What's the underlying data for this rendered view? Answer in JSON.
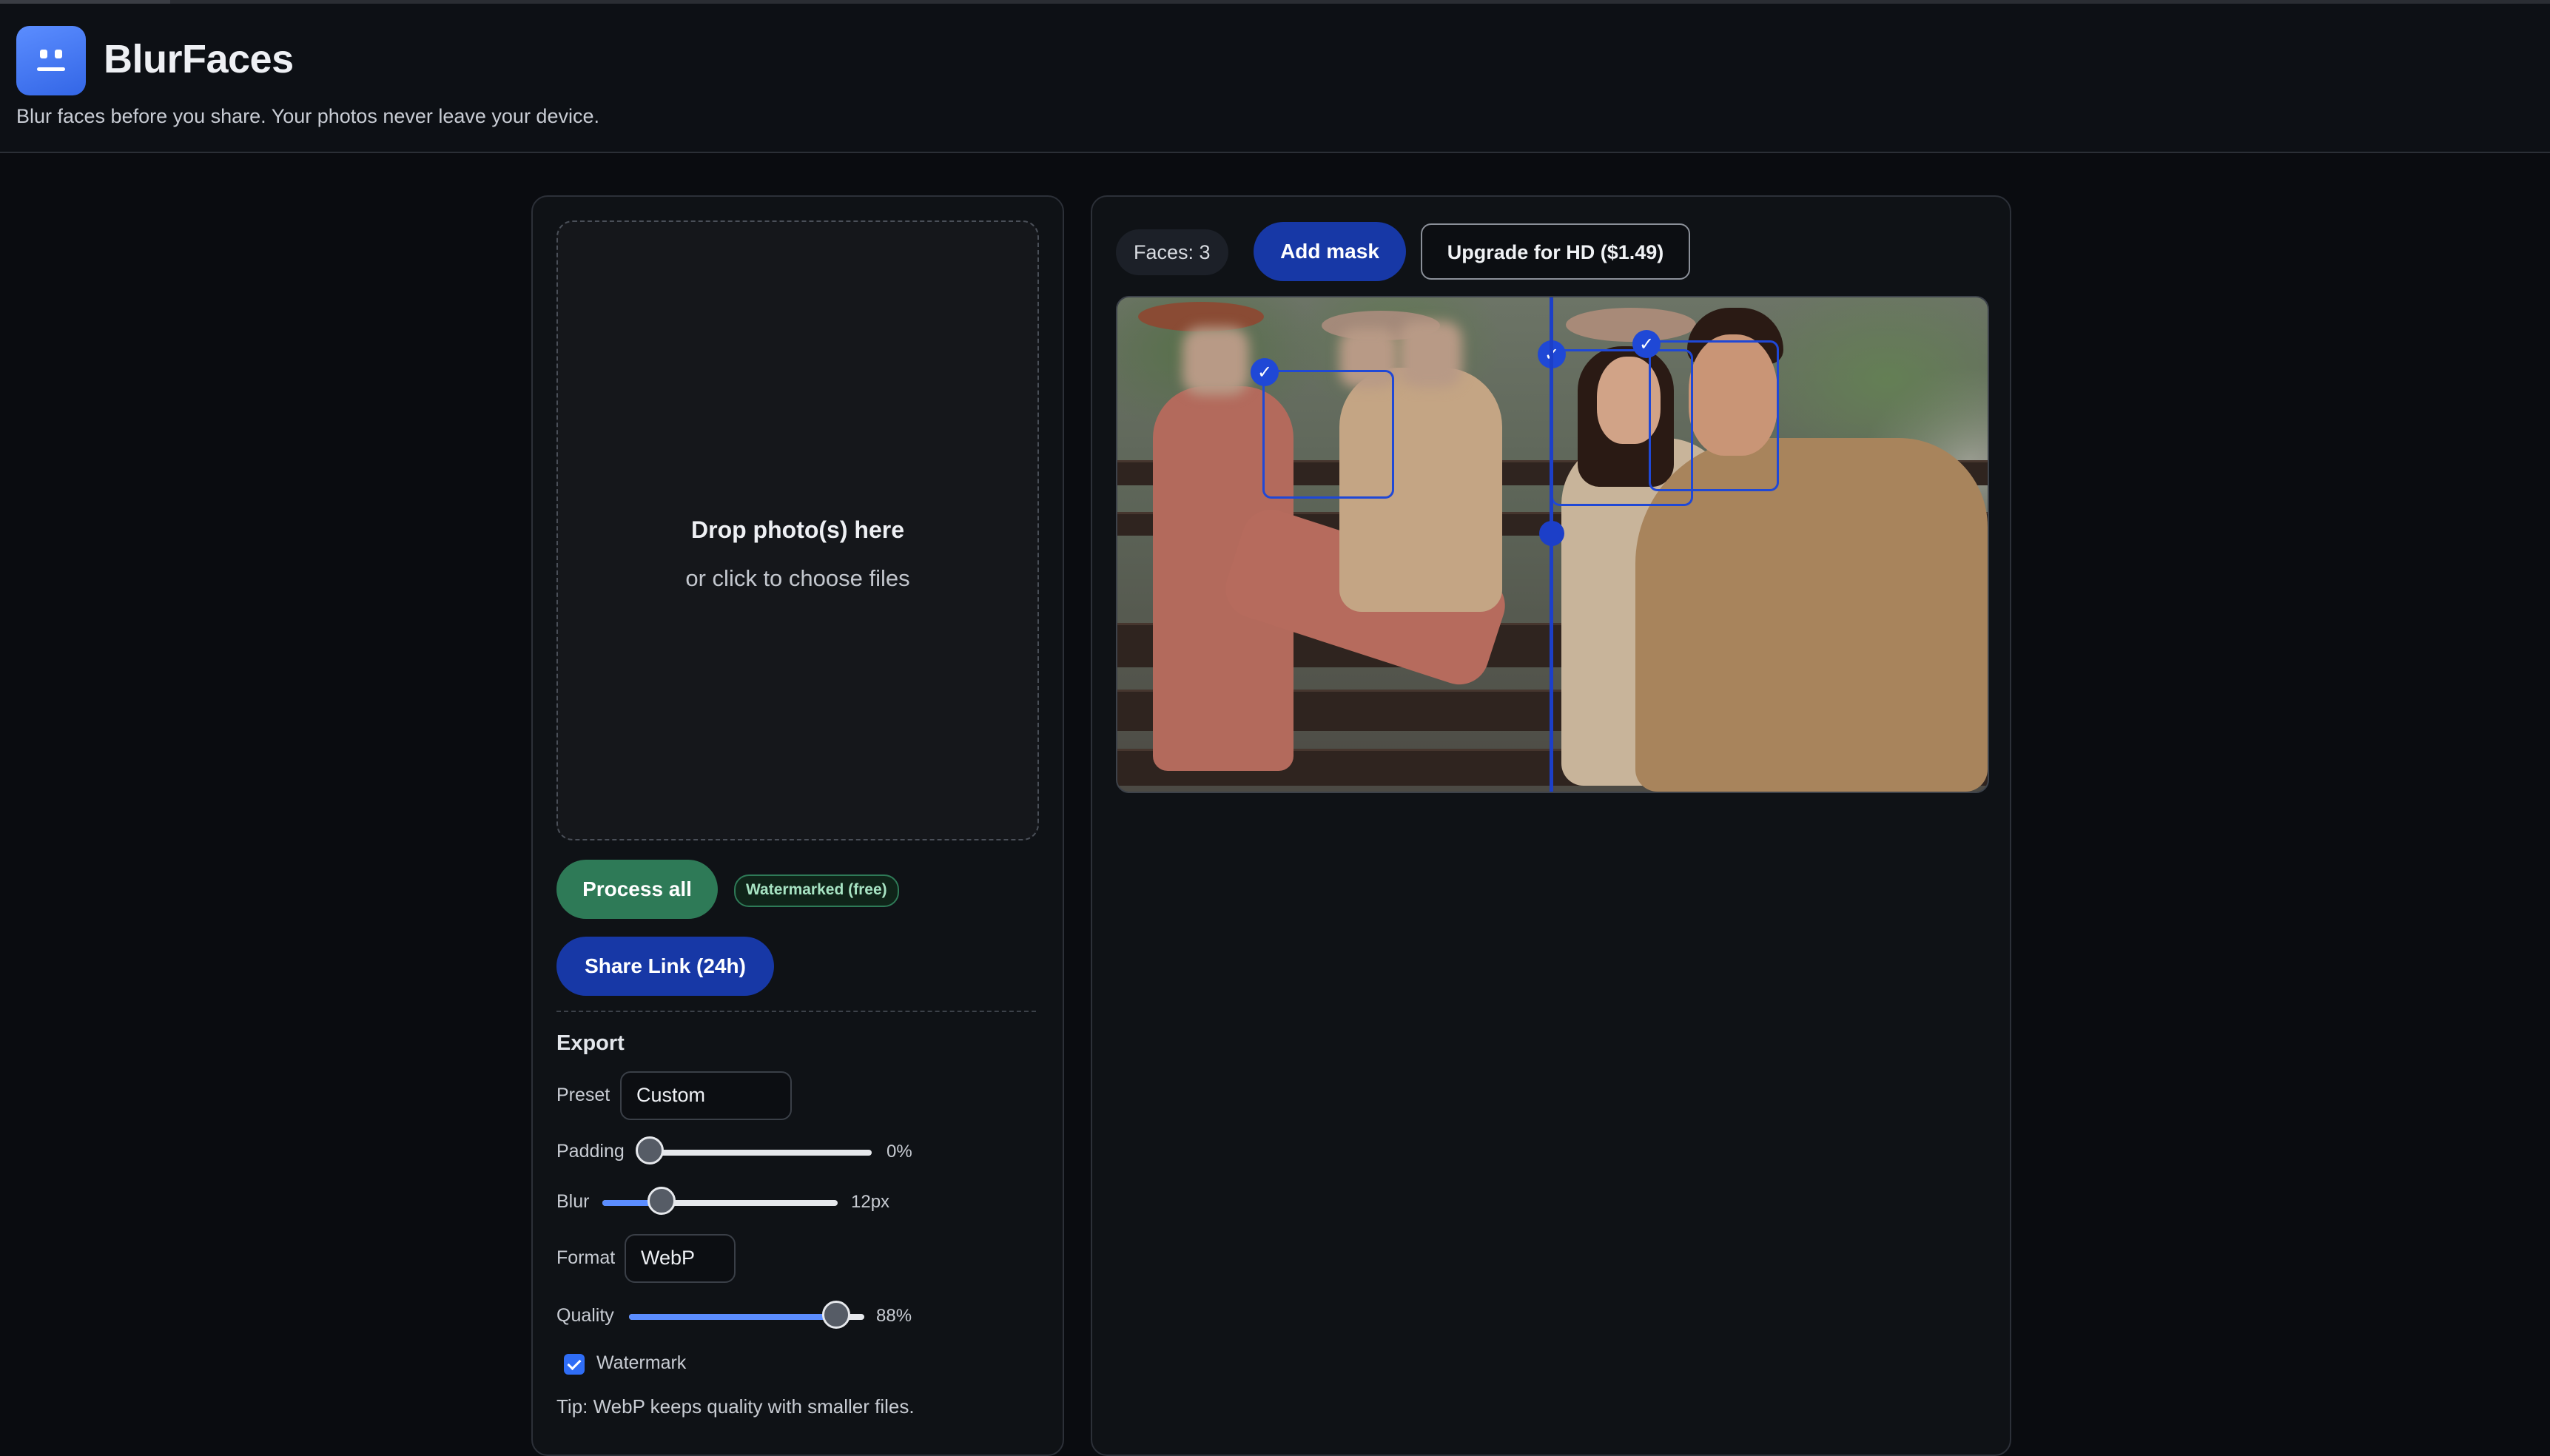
{
  "app": {
    "name": "BlurFaces",
    "tagline": "Blur faces before you share. Your photos never leave your device.",
    "logo_icon": "face-icon",
    "accent": "#3366e6"
  },
  "upload": {
    "title": "Drop photo(s) here",
    "subtitle": "or click to choose files"
  },
  "actions": {
    "process_label": "Process all",
    "process_color": "#2e7a57",
    "free_badge": "Watermarked (free)",
    "share_label": "Share Link (24h)"
  },
  "export": {
    "title": "Export",
    "preset": {
      "label": "Preset",
      "value": "Custom"
    },
    "padding": {
      "label": "Padding",
      "value": 0,
      "display": "0%"
    },
    "blur": {
      "label": "Blur",
      "value": 12,
      "max": 48,
      "display": "12px"
    },
    "format": {
      "label": "Format",
      "value": "WebP"
    },
    "quality": {
      "label": "Quality",
      "value": 88,
      "display": "88%"
    },
    "watermark": {
      "label": "Watermark",
      "checked": true
    },
    "tip": "Tip: WebP keeps quality with smaller files."
  },
  "preview": {
    "faces_label": "Faces: 3",
    "add_mask_label": "Add mask",
    "upgrade_label": "Upgrade for HD ($1.49)",
    "mask_color": "#1f48d6",
    "check_icon": "check-icon"
  }
}
